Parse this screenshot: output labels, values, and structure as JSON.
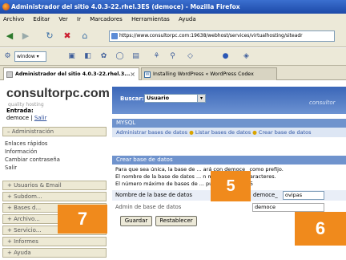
{
  "window": {
    "title": "Administrador del sitio 4.0.3-22.rhel.3ES (democe) - Mozilla Firefox"
  },
  "menu": [
    "Archivo",
    "Editar",
    "Ver",
    "Ir",
    "Marcadores",
    "Herramientas",
    "Ayuda"
  ],
  "address": {
    "url": "https://www.consultorpc.com:19638/webhost/services/virtualhosting/siteadr"
  },
  "toolbar2": {
    "select_value": "window"
  },
  "tabs": [
    {
      "label": "Administrador del sitio 4.0.3-22.rhel.3..."
    },
    {
      "label": "Installing WordPress « WordPress Codex"
    }
  ],
  "site": {
    "logo": "consultorpc.com",
    "tagline": "quality hosting",
    "entrada_label": "Entrada:",
    "user": "democe",
    "logout": "Salir"
  },
  "sidebar": {
    "admin_header": "Administración",
    "admin_items": [
      "Enlaces rápidos",
      "Información",
      "Cambiar contraseña",
      "Salir"
    ],
    "sections": [
      "Usuarios & Email",
      "Subdom...",
      "Bases d...",
      "Archivo...",
      "Servicio...",
      "Informes",
      "Ayuda"
    ]
  },
  "main": {
    "search_label": "Buscar:",
    "search_value": "Usuario",
    "brand": "consultor",
    "mysql_title": "MYSQL",
    "subnav_a": "Administrar bases de datos",
    "subnav_b": "Listar bases de datos",
    "subnav_c": "Crear base de datos",
    "section_title": "Crear base de datos",
    "desc1": "Para que sea única, la base de ... ará con democe_ como prefijo.",
    "desc2": "El nombre de la base de datos ... n máximo de 54 caracteres.",
    "desc3": "El número máximo de bases de ... pueden crear es 5",
    "db_name_label": "Nombre de la base de datos",
    "db_prefix": "democe_",
    "db_name_value": "ovipas",
    "db_admin_label": "Admin de base de datos",
    "db_admin_value": "democe",
    "save_button": "Guardar",
    "reset_button": "Restablecer"
  },
  "badges": {
    "b5": "5",
    "b6": "6",
    "b7": "7"
  },
  "colors": {
    "accent_orange": "#f08a1c",
    "header_blue": "#3a66b8"
  }
}
